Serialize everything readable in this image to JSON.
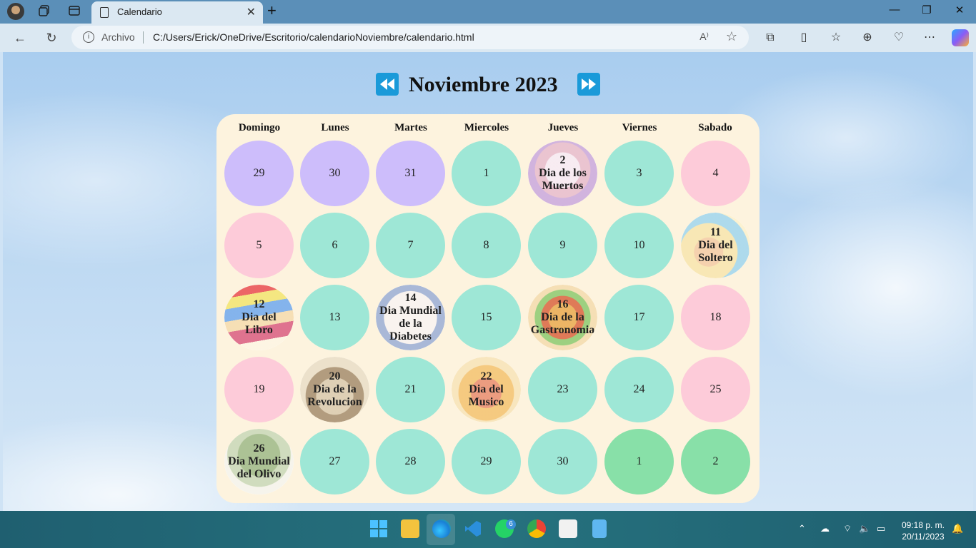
{
  "browser": {
    "tab_title": "Calendario",
    "address_prefix": "Archivo",
    "url": "C:/Users/Erick/OneDrive/Escritorio/calendarioNoviembre/calendario.html",
    "read_aloud_glyph": "A⁾",
    "winctl": {
      "minimize": "—",
      "restore": "❐",
      "close": "✕"
    }
  },
  "calendar": {
    "title": "Noviembre 2023",
    "day_names": [
      "Domingo",
      "Lunes",
      "Martes",
      "Miercoles",
      "Jueves",
      "Viernes",
      "Sabado"
    ],
    "weeks": [
      [
        {
          "lines": [
            "29"
          ],
          "kind": "prev"
        },
        {
          "lines": [
            "30"
          ],
          "kind": "prev"
        },
        {
          "lines": [
            "31"
          ],
          "kind": "prev"
        },
        {
          "lines": [
            "1"
          ],
          "kind": "weekday"
        },
        {
          "lines": [
            "2",
            "Dia de los",
            "Muertos"
          ],
          "kind": "event",
          "icon": "skull-flowers-image"
        },
        {
          "lines": [
            "3"
          ],
          "kind": "weekday"
        },
        {
          "lines": [
            "4"
          ],
          "kind": "weekend"
        }
      ],
      [
        {
          "lines": [
            "5"
          ],
          "kind": "weekend"
        },
        {
          "lines": [
            "6"
          ],
          "kind": "weekday"
        },
        {
          "lines": [
            "7"
          ],
          "kind": "weekday"
        },
        {
          "lines": [
            "8"
          ],
          "kind": "weekday"
        },
        {
          "lines": [
            "9"
          ],
          "kind": "weekday"
        },
        {
          "lines": [
            "10"
          ],
          "kind": "weekday"
        },
        {
          "lines": [
            "11",
            "Dia del",
            "Soltero"
          ],
          "kind": "event",
          "icon": "single-person-image"
        }
      ],
      [
        {
          "lines": [
            "12",
            "Dia del",
            "Libro"
          ],
          "kind": "event",
          "icon": "books-image"
        },
        {
          "lines": [
            "13"
          ],
          "kind": "weekday"
        },
        {
          "lines": [
            "14",
            "Dia Mundial",
            "de la",
            "Diabetes"
          ],
          "kind": "event",
          "icon": "diabetes-ring-image"
        },
        {
          "lines": [
            "15"
          ],
          "kind": "weekday"
        },
        {
          "lines": [
            "16",
            "Dia de la",
            "Gastronomia"
          ],
          "kind": "event",
          "icon": "tacos-image"
        },
        {
          "lines": [
            "17"
          ],
          "kind": "weekday"
        },
        {
          "lines": [
            "18"
          ],
          "kind": "weekend"
        }
      ],
      [
        {
          "lines": [
            "19"
          ],
          "kind": "weekend"
        },
        {
          "lines": [
            "20",
            "Dia de la",
            "Revolucion"
          ],
          "kind": "event",
          "icon": "revolution-portrait-image"
        },
        {
          "lines": [
            "21"
          ],
          "kind": "weekday"
        },
        {
          "lines": [
            "22",
            "Dia del",
            "Musico"
          ],
          "kind": "event",
          "icon": "musician-image"
        },
        {
          "lines": [
            "23"
          ],
          "kind": "weekday"
        },
        {
          "lines": [
            "24"
          ],
          "kind": "weekday"
        },
        {
          "lines": [
            "25"
          ],
          "kind": "weekend"
        }
      ],
      [
        {
          "lines": [
            "26",
            "Dia Mundial",
            "del Olivo"
          ],
          "kind": "event",
          "icon": "olive-tree-image"
        },
        {
          "lines": [
            "27"
          ],
          "kind": "weekday"
        },
        {
          "lines": [
            "28"
          ],
          "kind": "weekday"
        },
        {
          "lines": [
            "29"
          ],
          "kind": "weekday"
        },
        {
          "lines": [
            "30"
          ],
          "kind": "weekday"
        },
        {
          "lines": [
            "1"
          ],
          "kind": "next"
        },
        {
          "lines": [
            "2"
          ],
          "kind": "next"
        }
      ]
    ]
  },
  "colors": {
    "prev": "#cdbdfb",
    "weekday": "#9ee7d6",
    "weekend": "#fdcbd9",
    "next": "#88e0a8",
    "calendar_bg": "#fdf3de",
    "arrow_bg": "#1a9ad9"
  },
  "taskbar": {
    "whatsapp_badge": "6",
    "time": "09:18 p. m.",
    "date": "20/11/2023"
  }
}
